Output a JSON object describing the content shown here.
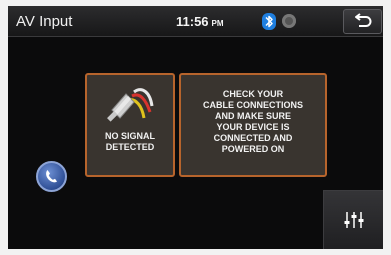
{
  "header": {
    "title": "AV Input",
    "time": "11:56",
    "ampm": "PM"
  },
  "status_icons": [
    "bluetooth-icon",
    "record-icon"
  ],
  "buttons": [
    "back-icon",
    "phone-icon",
    "equalizer-icon"
  ],
  "no_signal_card": {
    "line1": "NO SIGNAL",
    "line2": "DETECTED"
  },
  "instructions_card": {
    "line1": "CHECK YOUR",
    "line2": "CABLE CONNECTIONS",
    "line3": "AND MAKE SURE",
    "line4": "YOUR DEVICE IS",
    "line5": "CONNECTED AND",
    "line6": "POWERED ON"
  },
  "colors": {
    "background": "#0b0b0c",
    "card": "#39342f",
    "card_border": "#b7642c",
    "bluetooth": "#1f7fe0",
    "phone_button": "#3b5ba3"
  }
}
